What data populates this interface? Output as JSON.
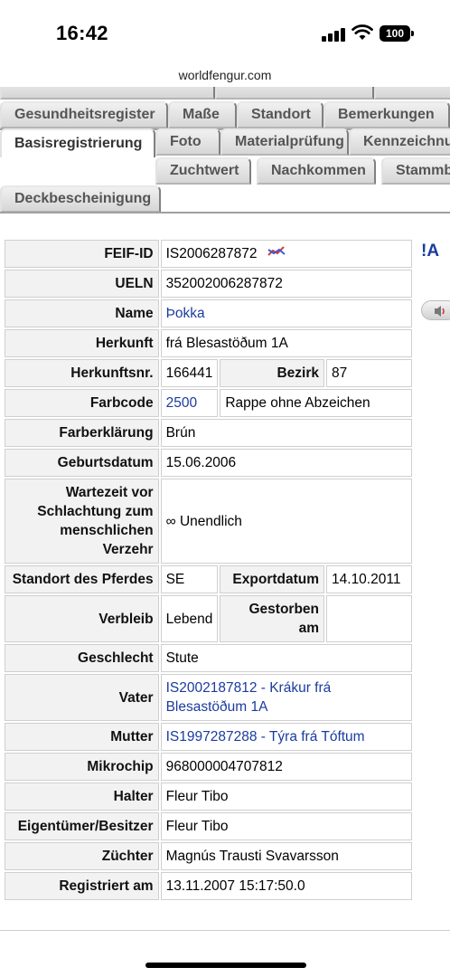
{
  "status": {
    "time": "16:42",
    "battery": "100"
  },
  "browser": {
    "url": "worldfengur.com"
  },
  "tabs": {
    "row1": [
      "Gesundheitsregister",
      "Maße",
      "Standort",
      "Bemerkungen"
    ],
    "row2": [
      "Basisregistrierung",
      "Foto",
      "Materialprüfung",
      "Kennzeichnung"
    ],
    "row3": [
      "Zuchtwert",
      "Nachkommen",
      "Stammbaum"
    ],
    "row4": [
      "Deckbescheinigung"
    ],
    "active": "Basisregistrierung"
  },
  "side": {
    "mark": "!A"
  },
  "details": {
    "feif_id": {
      "label": "FEIF-ID",
      "value": "IS2006287872"
    },
    "ueln": {
      "label": "UELN",
      "value": "352002006287872"
    },
    "name": {
      "label": "Name",
      "value": "Þokka"
    },
    "herkunft": {
      "label": "Herkunft",
      "value": "frá Blesastöðum 1A"
    },
    "herkunftsnr": {
      "label": "Herkunftsnr.",
      "value": "166441"
    },
    "bezirk": {
      "label": "Bezirk",
      "value": "87"
    },
    "farbcode": {
      "label": "Farbcode",
      "value": "2500",
      "desc": "Rappe ohne Abzeichen"
    },
    "farberklaerung": {
      "label": "Farberklärung",
      "value": "Brún"
    },
    "geburtsdatum": {
      "label": "Geburtsdatum",
      "value": "15.06.2006"
    },
    "wartezeit": {
      "label": "Wartezeit vor Schlachtung zum menschlichen Verzehr",
      "symbol": "∞",
      "value": "Unendlich"
    },
    "standort": {
      "label": "Standort des Pferdes",
      "value": "SE"
    },
    "exportdatum": {
      "label": "Exportdatum",
      "value": "14.10.2011"
    },
    "verbleib": {
      "label": "Verbleib",
      "value": "Lebend"
    },
    "gestorben": {
      "label": "Gestorben am",
      "value": ""
    },
    "geschlecht": {
      "label": "Geschlecht",
      "value": "Stute"
    },
    "vater": {
      "label": "Vater",
      "value": "IS2002187812 - Krákur frá Blesastöðum 1A"
    },
    "mutter": {
      "label": "Mutter",
      "value": "IS1997287288 - Týra frá Tóftum"
    },
    "mikrochip": {
      "label": "Mikrochip",
      "value": "968000004707812"
    },
    "halter": {
      "label": "Halter",
      "value": "Fleur Tibo"
    },
    "eigentuemer": {
      "label": "Eigentümer/Besitzer",
      "value": "Fleur Tibo"
    },
    "zuechter": {
      "label": "Züchter",
      "value": "Magnús Trausti Svavarsson"
    },
    "registriert": {
      "label": "Registriert am",
      "value": "13.11.2007 15:17:50.0"
    }
  },
  "colors": {
    "link": "#1a3c9e",
    "warning": "#d40000",
    "label_bg": "#f2f2f2"
  }
}
